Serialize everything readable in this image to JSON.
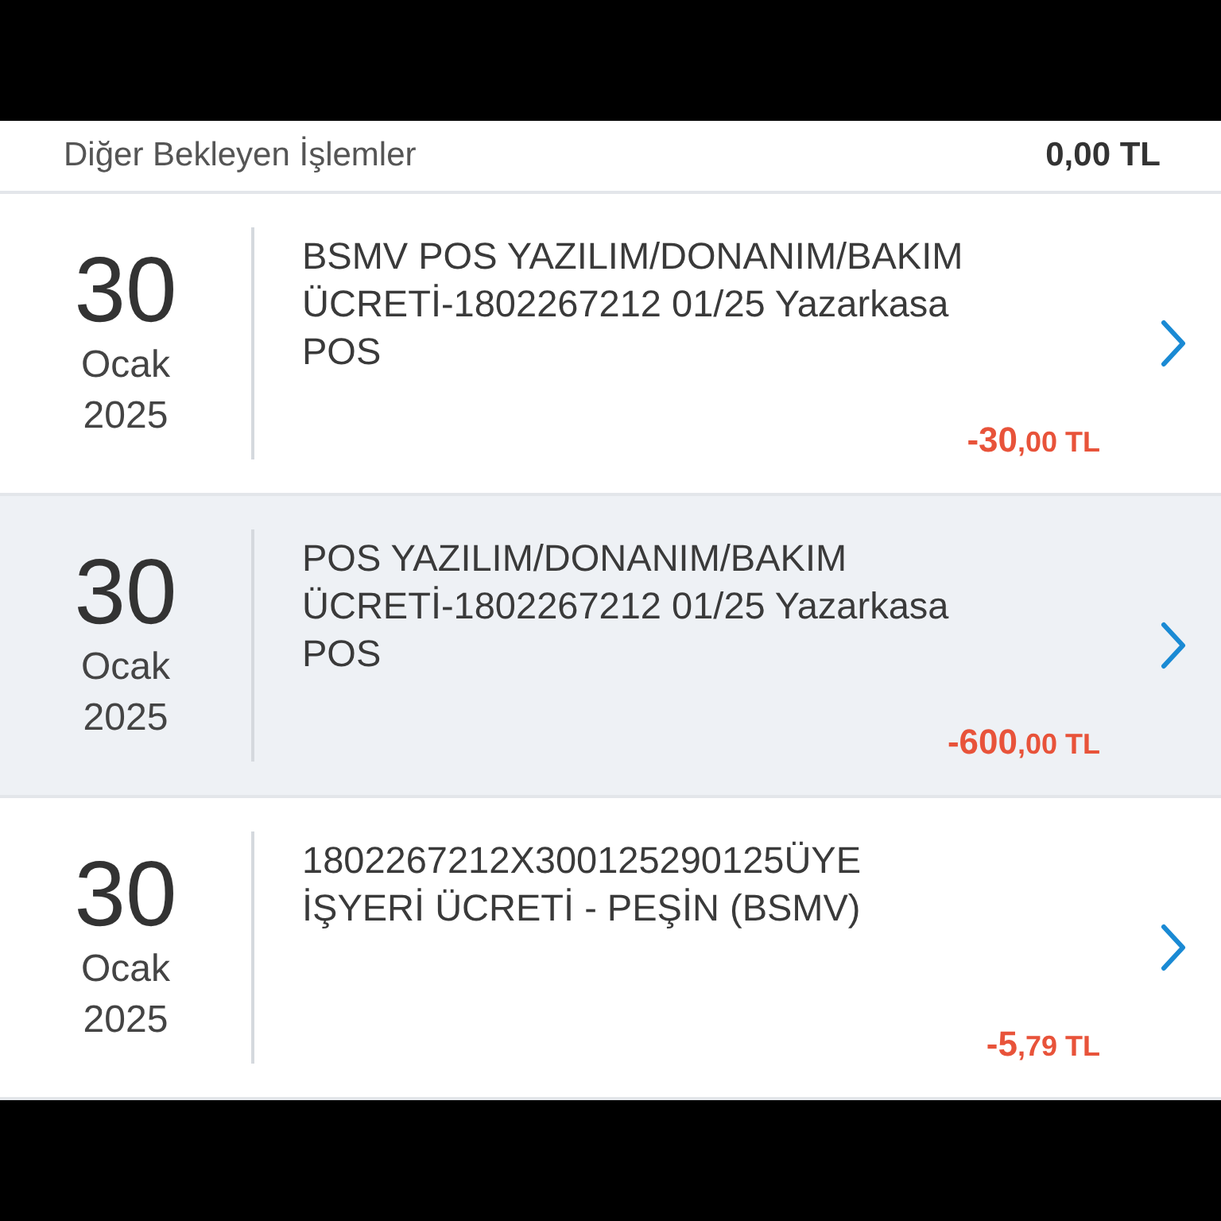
{
  "pending_row": {
    "label": "Diğer Bekleyen İşlemler",
    "amount": "0,00 TL"
  },
  "transactions": [
    {
      "day": "30",
      "month": "Ocak",
      "year": "2025",
      "description": "BSMV POS YAZILIM/DONANIM/BAKIM ÜCRETİ-1802267212 01/25 Yazarkasa POS",
      "amount_whole": "-30",
      "amount_rest": ",00 TL",
      "selected": false
    },
    {
      "day": "30",
      "month": "Ocak",
      "year": "2025",
      "description": "POS YAZILIM/DONANIM/BAKIM ÜCRETİ-1802267212 01/25 Yazarkasa POS",
      "amount_whole": "-600",
      "amount_rest": ",00 TL",
      "selected": true
    },
    {
      "day": "30",
      "month": "Ocak",
      "year": "2025",
      "description": "1802267212X300125290125ÜYE İŞYERİ ÜCRETİ - PEŞİN (BSMV)",
      "amount_whole": "-5",
      "amount_rest": ",79 TL",
      "selected": false
    }
  ]
}
